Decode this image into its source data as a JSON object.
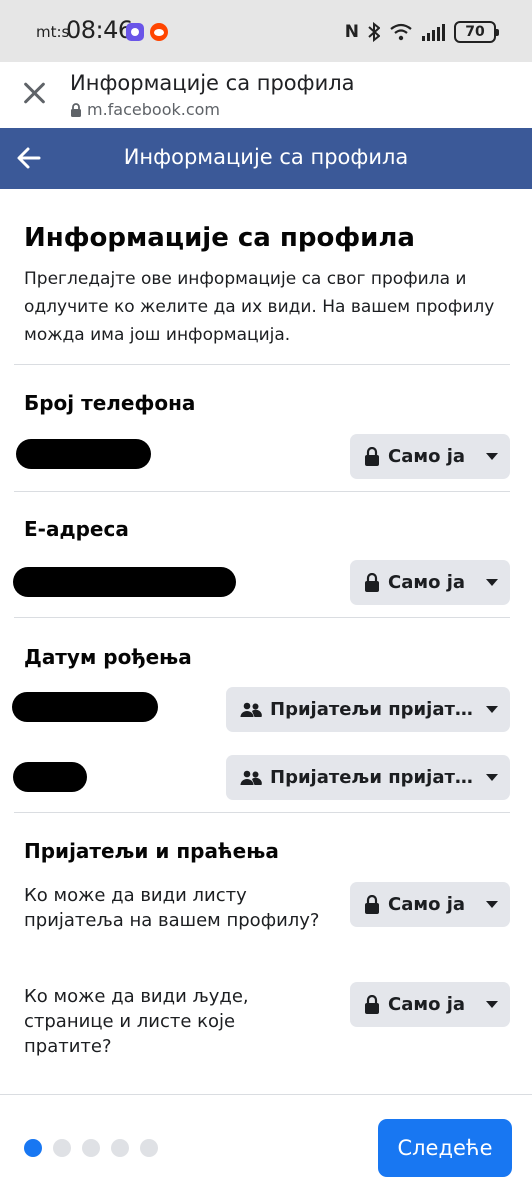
{
  "status_bar": {
    "carrier": "mt:s",
    "time": "08:46",
    "battery": "70"
  },
  "browser": {
    "title": "Информације са профила",
    "url": "m.facebook.com"
  },
  "header": {
    "title": "Информације са профила"
  },
  "page": {
    "title": "Информације са профила",
    "description": "Прегледајте ове информације са свог профила и одлучите ко желите да их види. На вашем профилу можда има још информација."
  },
  "sections": {
    "phone": {
      "title": "Број телефона",
      "privacy": "Само ја"
    },
    "email": {
      "title": "Е-адреса",
      "privacy": "Само ја"
    },
    "birthday": {
      "title": "Датум рођења",
      "privacy_1": "Пријатељи пријатеља",
      "privacy_2": "Пријатељи пријатеља"
    },
    "friends": {
      "title": "Пријатељи и праћења",
      "q1": "Ко може да види листу пријатеља на вашем профилу?",
      "q1_privacy": "Само ја",
      "q2": "Ко може да види људе, странице и листе које пратите?",
      "q2_privacy": "Само ја"
    }
  },
  "footer": {
    "step_total": 5,
    "step_current": 1,
    "next_label": "Следеће"
  },
  "colors": {
    "fb_header": "#3b5998",
    "primary_button": "#1877f2",
    "privacy_button_bg": "#e4e6eb"
  },
  "icons": {
    "close": "close-icon",
    "back": "arrow-left-icon",
    "lock": "lock-icon",
    "friends": "friends-icon",
    "dropdown": "caret-down-icon"
  }
}
